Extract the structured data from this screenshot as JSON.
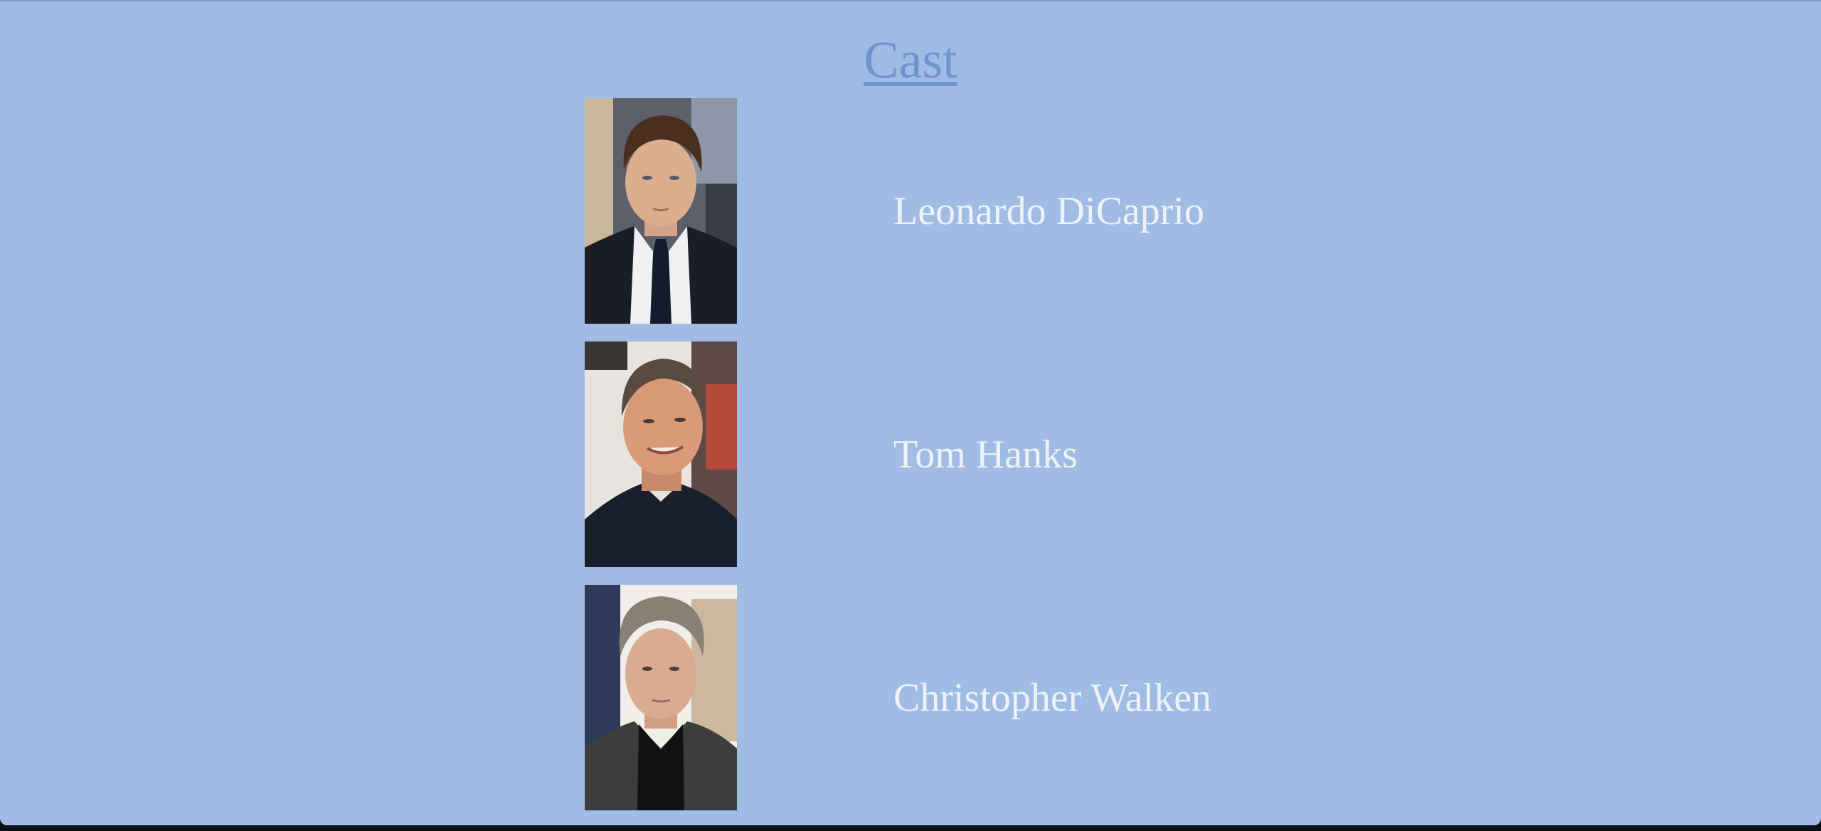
{
  "page": {
    "title": "Cast",
    "background_color": "#a0bce4",
    "link_color": "#6f94cf",
    "text_color": "#eef2f8"
  },
  "cast": [
    {
      "name": "Leonardo DiCaprio",
      "photo_icon": "actor-portrait-photo"
    },
    {
      "name": "Tom Hanks",
      "photo_icon": "actor-portrait-photo"
    },
    {
      "name": "Christopher Walken",
      "photo_icon": "actor-portrait-photo"
    }
  ]
}
